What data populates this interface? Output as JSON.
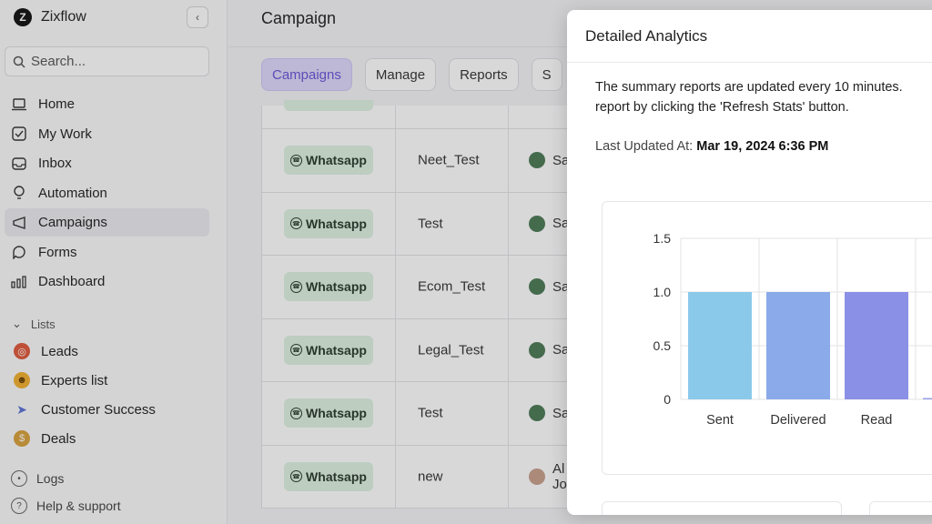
{
  "brand": {
    "name": "Zixflow",
    "logo_letter": "Z"
  },
  "sidebar": {
    "search_placeholder": "Search...",
    "nav": [
      {
        "label": "Home",
        "icon": "laptop-icon"
      },
      {
        "label": "My Work",
        "icon": "checkbox-icon"
      },
      {
        "label": "Inbox",
        "icon": "inbox-icon"
      },
      {
        "label": "Automation",
        "icon": "bulb-icon"
      },
      {
        "label": "Campaigns",
        "icon": "campaign-icon",
        "active": true
      },
      {
        "label": "Forms",
        "icon": "forms-icon"
      },
      {
        "label": "Dashboard",
        "icon": "bars-icon"
      }
    ],
    "lists_label": "Lists",
    "lists": [
      {
        "label": "Leads",
        "icon": "target-icon",
        "color": "#e05a3a"
      },
      {
        "label": "Experts list",
        "icon": "face-icon",
        "color": "#f2b02e"
      },
      {
        "label": "Customer Success",
        "icon": "rocket-icon",
        "color": "#5a6fd6"
      },
      {
        "label": "Deals",
        "icon": "moneybag-icon",
        "color": "#d8a23a"
      }
    ],
    "footer": [
      {
        "label": "Logs",
        "icon": "clock-icon"
      },
      {
        "label": "Help & support",
        "icon": "help-icon"
      }
    ]
  },
  "main": {
    "title": "Campaign",
    "tabs": [
      "Campaigns",
      "Manage",
      "Reports",
      "S"
    ],
    "rows": [
      {
        "channel": "Whatsapp",
        "name": "Neet_Test",
        "owner": "Sa"
      },
      {
        "channel": "Whatsapp",
        "name": "Test",
        "owner": "Sa"
      },
      {
        "channel": "Whatsapp",
        "name": "Ecom_Test",
        "owner": "Sa"
      },
      {
        "channel": "Whatsapp",
        "name": "Legal_Test",
        "owner": "Sa"
      },
      {
        "channel": "Whatsapp",
        "name": "Test",
        "owner": "Sa"
      },
      {
        "channel": "Whatsapp",
        "name": "new",
        "owner": "Al\nJo"
      }
    ]
  },
  "modal": {
    "title": "Detailed Analytics",
    "desc_line1": "The summary reports are updated every 10 minutes.",
    "desc_line2": "report by clicking the 'Refresh Stats' button.",
    "updated_label": "Last Updated At:",
    "updated_value": "Mar 19, 2024 6:36 PM"
  },
  "chart_data": {
    "type": "bar",
    "categories": [
      "Sent",
      "Delivered",
      "Read",
      ""
    ],
    "values": [
      1,
      1,
      1,
      0
    ],
    "colors": [
      "#8bc9ea",
      "#8aaaea",
      "#8a90e6",
      "#9aa0e6"
    ],
    "yticks": [
      0,
      0.5,
      1.0,
      1.5
    ],
    "ytick_labels": [
      "0",
      "0.5",
      "1.0",
      "1.5"
    ],
    "ylim": [
      0,
      1.5
    ]
  }
}
